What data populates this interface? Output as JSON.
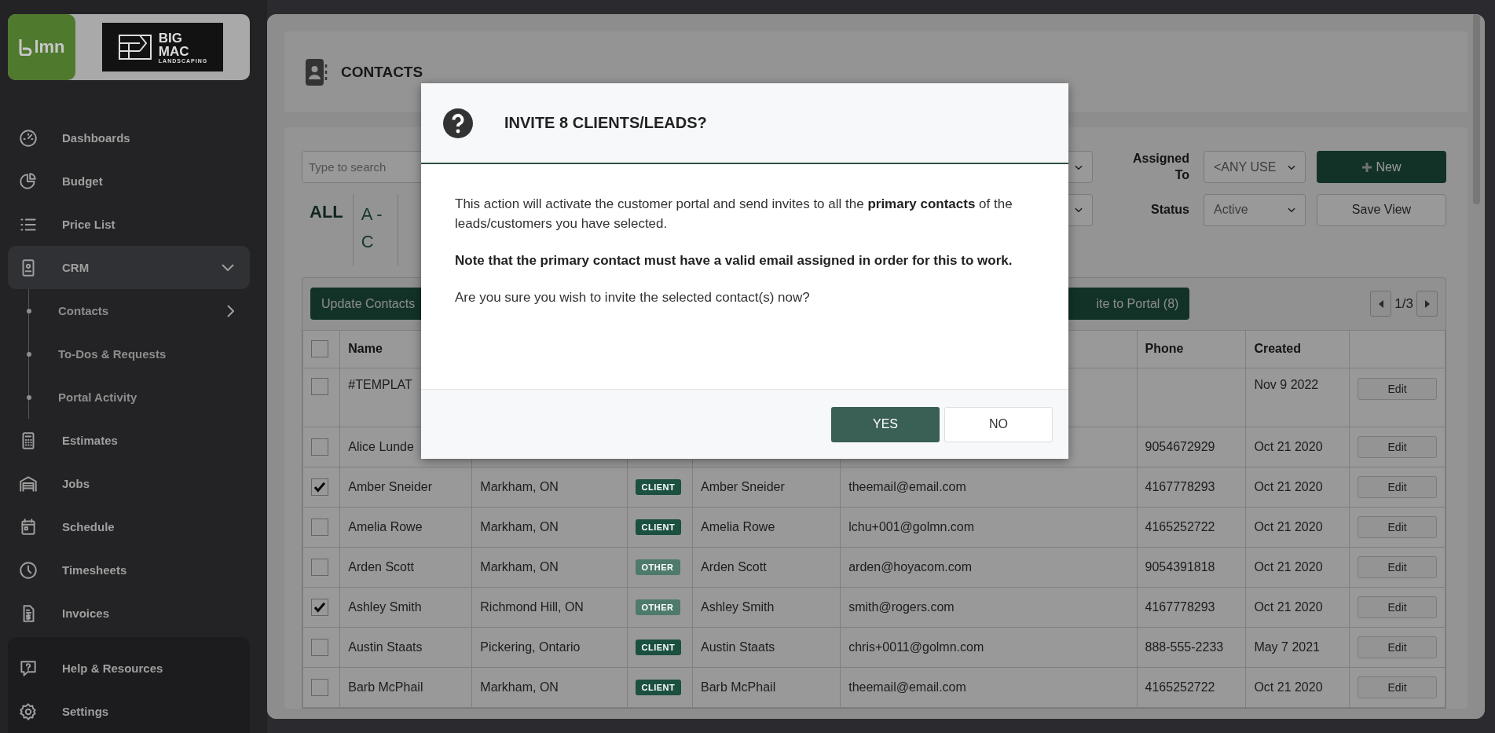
{
  "sidebar": {
    "logos": {
      "app": "lmn",
      "company_line_1": "BIG",
      "company_line_2": "MAC",
      "company_line_3": "LANDSCAPING"
    },
    "items": [
      {
        "label": "Dashboards",
        "selected": false
      },
      {
        "label": "Budget",
        "selected": false
      },
      {
        "label": "Price List",
        "selected": false
      },
      {
        "label": "CRM",
        "selected": true,
        "expanded": true,
        "children": [
          {
            "label": "Contacts",
            "submenu": true
          },
          {
            "label": "To-Dos & Requests",
            "submenu": false
          },
          {
            "label": "Portal Activity",
            "submenu": false
          }
        ]
      },
      {
        "label": "Estimates",
        "selected": false
      },
      {
        "label": "Jobs",
        "selected": false
      },
      {
        "label": "Schedule",
        "selected": false
      },
      {
        "label": "Timesheets",
        "selected": false
      },
      {
        "label": "Invoices",
        "selected": false
      }
    ],
    "footer_items": [
      {
        "label": "Help & Resources"
      },
      {
        "label": "Settings"
      }
    ]
  },
  "page_title": "CONTACTS",
  "filters": {
    "search_placeholder": "Type to search",
    "assigned_to_label": "Assigned To",
    "assigned_to_value": "<ANY USE",
    "status_label": "Status",
    "status_value": "Active",
    "new_button": "New",
    "save_view_button": "Save View",
    "alphabet": [
      {
        "label": "ALL",
        "selected": true
      },
      {
        "label": "A - C",
        "selected": false
      }
    ]
  },
  "table": {
    "toolbar": {
      "update_button": "Update Contacts",
      "invite_button": "ite to Portal (8)",
      "page": "1/3"
    },
    "all_checked": false,
    "columns": {
      "name": "Name",
      "phone": "Phone",
      "created": "Created"
    },
    "rows": [
      {
        "checked": false,
        "name": "#TEMPLAT",
        "created": "Nov 9 2022",
        "action": "Edit"
      },
      {
        "checked": false,
        "name": "Alice Lunde",
        "phone": "9054672929",
        "created": "Oct 21 2020",
        "action": "Edit"
      },
      {
        "checked": true,
        "name": "Amber Sneider",
        "location": "Markham, ON",
        "type": {
          "label": "CLIENT",
          "color": "#1b4f40"
        },
        "contact": "Amber Sneider",
        "email": "theemail@email.com",
        "phone": "4167778293",
        "created": "Oct 21 2020",
        "action": "Edit"
      },
      {
        "checked": false,
        "name": "Amelia Rowe",
        "location": "Markham, ON",
        "type": {
          "label": "CLIENT",
          "color": "#1b4f40"
        },
        "contact": "Amelia Rowe",
        "email": "lchu+001@golmn.com",
        "phone": "4165252722",
        "created": "Oct 21 2020",
        "action": "Edit"
      },
      {
        "checked": false,
        "name": "Arden Scott",
        "location": "Markham, ON",
        "type": {
          "label": "OTHER",
          "color": "#4d7a6b"
        },
        "contact": "Arden Scott",
        "email": "arden@hoyacom.com",
        "phone": "9054391818",
        "created": "Oct 21 2020",
        "action": "Edit"
      },
      {
        "checked": true,
        "name": "Ashley Smith",
        "location": "Richmond Hill, ON",
        "type": {
          "label": "OTHER",
          "color": "#4d7a6b"
        },
        "contact": "Ashley Smith",
        "email": "smith@rogers.com",
        "phone": "4167778293",
        "created": "Oct 21 2020",
        "action": "Edit"
      },
      {
        "checked": false,
        "name": "Austin Staats",
        "location": "Pickering, Ontario",
        "type": {
          "label": "CLIENT",
          "color": "#1b4f40"
        },
        "contact": "Austin Staats",
        "email": "chris+0011@golmn.com",
        "phone": "888-555-2233",
        "created": "May 7 2021",
        "action": "Edit"
      },
      {
        "checked": false,
        "name": "Barb McPhail",
        "location": "Markham, ON",
        "type": {
          "label": "CLIENT",
          "color": "#1b4f40"
        },
        "contact": "Barb McPhail",
        "email": "theemail@email.com",
        "phone": "4165252722",
        "created": "Oct 21 2020",
        "action": "Edit"
      }
    ]
  },
  "dialog": {
    "title": "INVITE 8 CLIENTS/LEADS?",
    "paragraphs": [
      "This action will activate the customer portal and send invites to all the **primary contacts** of the leads/customers you have selected.",
      "**Note that the primary contact must have a valid email assigned in order for this to work.**",
      "Are you sure you wish to invite the selected contact(s) now?"
    ],
    "buttons": [
      {
        "label": "YES",
        "kind": "primary"
      },
      {
        "label": "NO",
        "kind": "secondary"
      }
    ]
  }
}
